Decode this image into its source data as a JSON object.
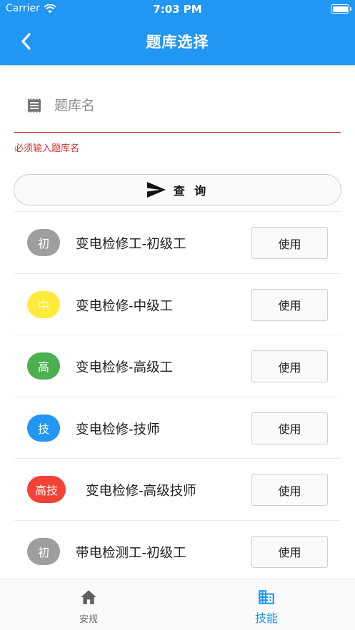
{
  "status_bar": {
    "carrier": "Carrier",
    "time": "7:03 PM"
  },
  "header": {
    "title": "题库选择",
    "back_icon": "chevron-left-icon"
  },
  "search": {
    "placeholder": "题库名",
    "value": "",
    "icon": "document-icon",
    "error": "必须输入题库名"
  },
  "query_button": {
    "label": "查 询",
    "icon": "send-icon"
  },
  "colors": {
    "primary": "#2196F3",
    "error": "#d32f2f",
    "gray": "#9e9e9e",
    "yellow": "#FFEB3B",
    "green": "#4CAF50",
    "blue": "#2196F3",
    "red": "#F44336"
  },
  "banks": [
    {
      "badge": "初",
      "badge_color": "#9e9e9e",
      "name": "变电检修工-初级工",
      "action": "使用"
    },
    {
      "badge": "中",
      "badge_color": "#FFEB3B",
      "name": "变电检修-中级工",
      "action": "使用"
    },
    {
      "badge": "高",
      "badge_color": "#4CAF50",
      "name": "变电检修-高级工",
      "action": "使用"
    },
    {
      "badge": "技",
      "badge_color": "#2196F3",
      "name": "变电检修-技师",
      "action": "使用"
    },
    {
      "badge": "高技",
      "badge_color": "#F44336",
      "name": "变电检修-高级技师",
      "action": "使用"
    },
    {
      "badge": "初",
      "badge_color": "#9e9e9e",
      "name": "带电检测工-初级工",
      "action": "使用"
    }
  ],
  "tabbar": {
    "tabs": [
      {
        "label": "安规",
        "icon": "home-icon",
        "active": false
      },
      {
        "label": "技能",
        "icon": "building-icon",
        "active": true
      }
    ]
  }
}
